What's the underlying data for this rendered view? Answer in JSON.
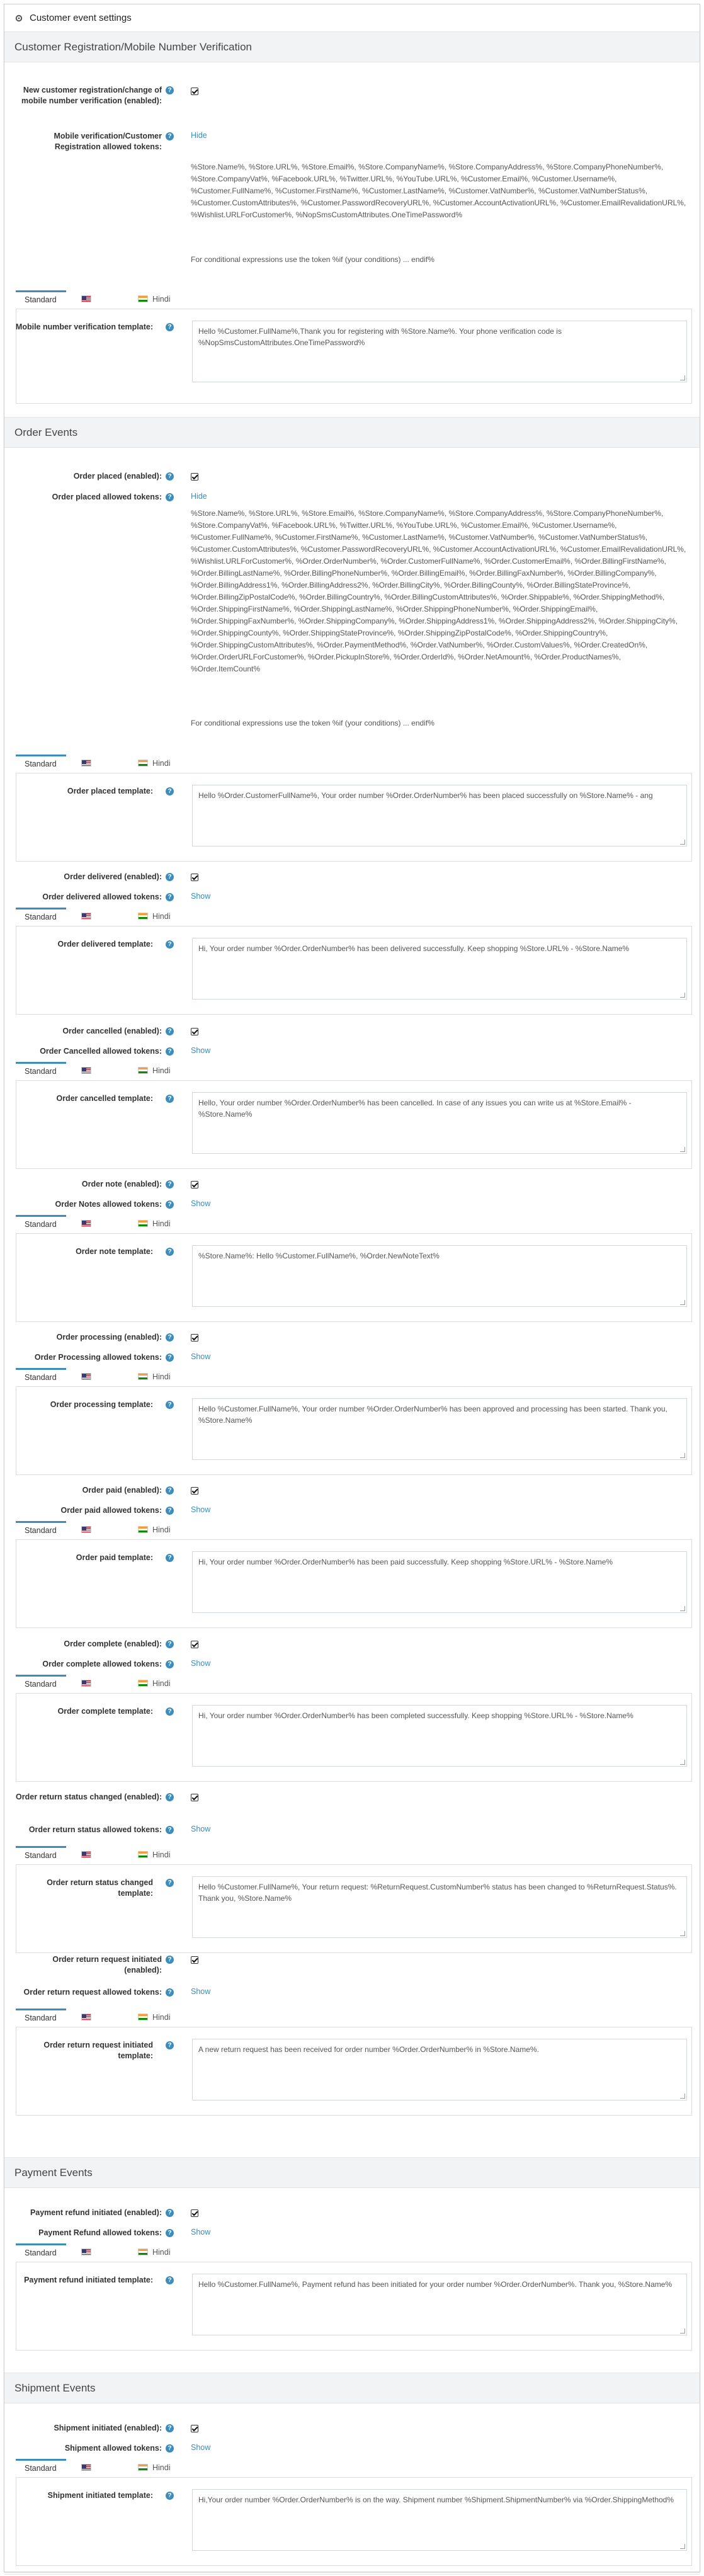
{
  "card_title": "Customer event settings",
  "help_glyph": "?",
  "tabs": [
    "Standard",
    "English",
    "Hindi"
  ],
  "groups": {
    "customer": {
      "title": "Customer Registration/Mobile Number Verification",
      "enabled_label": "New customer registration/change of mobile number verification (enabled):",
      "tokens_label": "Mobile verification/Customer Registration allowed tokens:",
      "toggle": "Hide",
      "tokens": "%Store.Name%, %Store.URL%, %Store.Email%, %Store.CompanyName%, %Store.CompanyAddress%, %Store.CompanyPhoneNumber%, %Store.CompanyVat%, %Facebook.URL%, %Twitter.URL%, %YouTube.URL%, %Customer.Email%, %Customer.Username%, %Customer.FullName%, %Customer.FirstName%, %Customer.LastName%, %Customer.VatNumber%, %Customer.VatNumberStatus%, %Customer.CustomAttributes%, %Customer.PasswordRecoveryURL%, %Customer.AccountActivationURL%, %Customer.EmailRevalidationURL%, %Wishlist.URLForCustomer%, %NopSmsCustomAttributes.OneTimePassword%",
      "cond": "For conditional expressions use the token %if (your conditions) ... endif%",
      "template_label": "Mobile number verification template:",
      "template": "Hello %Customer.FullName%,Thank you for registering with %Store.Name%. Your phone verification code is %NopSmsCustomAttributes.OneTimePassword%"
    },
    "order": {
      "title": "Order Events",
      "placed_enabled": "Order placed (enabled):",
      "placed_tokens_label": "Order placed allowed tokens:",
      "placed_toggle": "Hide",
      "placed_tokens": "%Store.Name%, %Store.URL%, %Store.Email%, %Store.CompanyName%, %Store.CompanyAddress%, %Store.CompanyPhoneNumber%, %Store.CompanyVat%, %Facebook.URL%, %Twitter.URL%, %YouTube.URL%, %Customer.Email%, %Customer.Username%, %Customer.FullName%, %Customer.FirstName%, %Customer.LastName%, %Customer.VatNumber%, %Customer.VatNumberStatus%, %Customer.CustomAttributes%, %Customer.PasswordRecoveryURL%, %Customer.AccountActivationURL%, %Customer.EmailRevalidationURL%, %Wishlist.URLForCustomer%, %Order.OrderNumber%, %Order.CustomerFullName%, %Order.CustomerEmail%, %Order.BillingFirstName%, %Order.BillingLastName%, %Order.BillingPhoneNumber%, %Order.BillingEmail%, %Order.BillingFaxNumber%, %Order.BillingCompany%, %Order.BillingAddress1%, %Order.BillingAddress2%, %Order.BillingCity%, %Order.BillingCounty%, %Order.BillingStateProvince%, %Order.BillingZipPostalCode%, %Order.BillingCountry%, %Order.BillingCustomAttributes%, %Order.Shippable%, %Order.ShippingMethod%, %Order.ShippingFirstName%, %Order.ShippingLastName%, %Order.ShippingPhoneNumber%, %Order.ShippingEmail%, %Order.ShippingFaxNumber%, %Order.ShippingCompany%, %Order.ShippingAddress1%, %Order.ShippingAddress2%, %Order.ShippingCity%, %Order.ShippingCounty%, %Order.ShippingStateProvince%, %Order.ShippingZipPostalCode%, %Order.ShippingCountry%, %Order.ShippingCustomAttributes%, %Order.PaymentMethod%, %Order.VatNumber%, %Order.CustomValues%, %Order.CreatedOn%, %Order.OrderURLForCustomer%, %Order.PickupInStore%, %Order.OrderId%, %Order.NetAmount%, %Order.ProductNames%, %Order.ItemCount%",
      "cond": "For conditional expressions use the token %if (your conditions) ... endif%",
      "placed_template_label": "Order placed template:",
      "placed_template": "Hello %Order.CustomerFullName%, Your order number %Order.OrderNumber% has been placed successfully on %Store.Name% - ang",
      "show": "Show",
      "delivered_enabled": "Order delivered (enabled):",
      "delivered_tokens_label": "Order delivered allowed tokens:",
      "delivered_template_label": "Order delivered template:",
      "delivered_template": "Hi, Your order number %Order.OrderNumber% has been delivered successfully. Keep shopping %Store.URL% - %Store.Name%",
      "cancelled_enabled": "Order cancelled (enabled):",
      "cancelled_tokens_label": "Order Cancelled allowed tokens:",
      "cancelled_template_label": "Order cancelled template:",
      "cancelled_template": "Hello, Your order number %Order.OrderNumber% has been cancelled. In case of any issues you can write us at %Store.Email% - %Store.Name%",
      "note_enabled": "Order note (enabled):",
      "note_tokens_label": "Order Notes allowed tokens:",
      "note_template_label": "Order note template:",
      "note_template": "%Store.Name%: Hello %Customer.FullName%, %Order.NewNoteText%",
      "processing_enabled": "Order processing (enabled):",
      "processing_tokens_label": "Order Processing allowed tokens:",
      "processing_template_label": "Order processing template:",
      "processing_template": "Hello %Customer.FullName%, Your order number %Order.OrderNumber% has been approved and processing has been started. Thank you, %Store.Name%",
      "paid_enabled": "Order paid (enabled):",
      "paid_tokens_label": "Order paid allowed tokens:",
      "paid_template_label": "Order paid template:",
      "paid_template": "Hi, Your order number %Order.OrderNumber% has been paid successfully. Keep shopping %Store.URL% - %Store.Name%",
      "complete_enabled": "Order complete (enabled):",
      "complete_tokens_label": "Order complete allowed tokens:",
      "complete_template_label": "Order complete template:",
      "complete_template": "Hi, Your order number %Order.OrderNumber% has been completed successfully. Keep shopping %Store.URL% - %Store.Name%",
      "return_status_enabled": "Order return status changed (enabled):",
      "return_status_tokens_label": "Order return status allowed tokens:",
      "return_status_template_label": "Order return status changed template:",
      "return_status_template": "Hello %Customer.FullName%, Your return request: %ReturnRequest.CustomNumber% status has been changed to %ReturnRequest.Status%. Thank you, %Store.Name%",
      "return_initiated_enabled": "Order return request initiated (enabled):",
      "return_initiated_tokens_label": "Order return request allowed tokens:",
      "return_initiated_template_label": "Order return request initiated template:",
      "return_initiated_template": "A new return request has been received for order number %Order.OrderNumber% in %Store.Name%."
    },
    "payment": {
      "title": "Payment Events",
      "enabled": "Payment refund initiated (enabled):",
      "tokens_label": "Payment Refund allowed tokens:",
      "show": "Show",
      "template_label": "Payment refund initiated template:",
      "template": "Hello %Customer.FullName%, Payment refund has been initiated for your order number %Order.OrderNumber%. Thank you, %Store.Name%"
    },
    "shipment": {
      "title": "Shipment Events",
      "enabled": "Shipment initiated (enabled):",
      "tokens_label": "Shipment allowed tokens:",
      "show": "Show",
      "template_label": "Shipment initiated template:",
      "template": "Hi,Your order number %Order.OrderNumber% is on the way. Shipment number %Shipment.ShipmentNumber% via %Order.ShippingMethod%"
    }
  }
}
